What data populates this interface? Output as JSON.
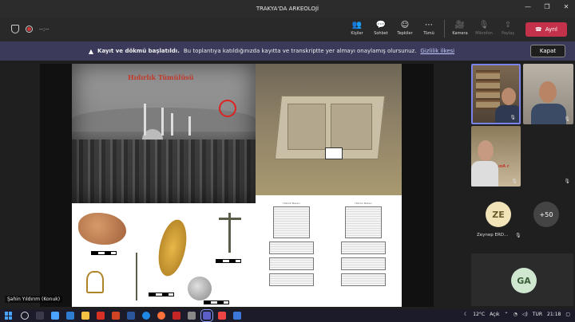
{
  "window": {
    "title": "TRAKYA'DA ARKEOLOJİ",
    "controls": [
      "—",
      "❐",
      "✕"
    ]
  },
  "toolbar": {
    "timer": "--:--",
    "items": [
      {
        "label": "Kişiler",
        "icon": "people-icon",
        "glyph": "👥"
      },
      {
        "label": "Sohbet",
        "icon": "chat-icon",
        "glyph": "💬"
      },
      {
        "label": "Tepkiler",
        "icon": "reactions-icon",
        "glyph": "☺"
      },
      {
        "label": "Tümü",
        "icon": "more-icon",
        "glyph": "⋯"
      }
    ],
    "media": [
      {
        "label": "Kamera",
        "icon": "camera-icon",
        "glyph": "🎥",
        "disabled": false
      },
      {
        "label": "Mikrofon",
        "icon": "microphone-icon",
        "glyph": "🎙",
        "disabled": true
      },
      {
        "label": "Paylaş",
        "icon": "share-icon",
        "glyph": "⇪",
        "disabled": true
      }
    ],
    "leave_label": "Ayrıl"
  },
  "banner": {
    "bold": "Kayıt ve dökmü başlatıldı.",
    "text": "Bu toplantıya katıldığınızda kayıtta ve transkriptte yer almayı onaylamış olursunuz.",
    "link": "Gizlilik ilkesi",
    "close_label": "Kapat"
  },
  "slide": {
    "title": "Hıdırlık Tümülüsü",
    "plan_headers": [
      "Hıdırlık Mezarı",
      "Hıdırlık Mezarı"
    ]
  },
  "presenter_label": "Şahin Yıldırım (Konuk)",
  "participants": {
    "tile3_sign": "ınA r",
    "ze_initials": "ZE",
    "ze_name": "Zeynep ERD...",
    "more_count": "+50",
    "ga_initials": "GA"
  },
  "taskbar": {
    "weather": "12°C",
    "condition": "Açık",
    "lang": "TUR",
    "time": "21:18"
  },
  "colors": {
    "accent": "#7b83eb",
    "leave": "#c4314b",
    "banner": "#3b3a5a"
  }
}
